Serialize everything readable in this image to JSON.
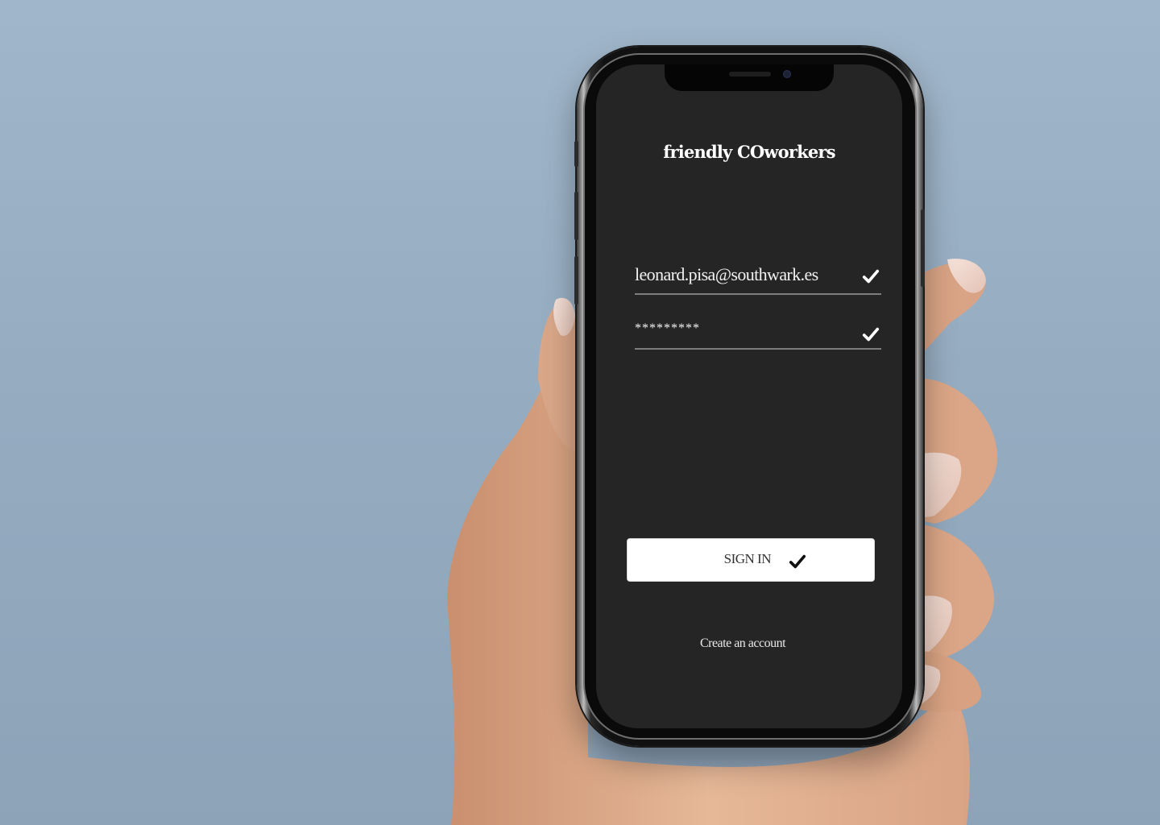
{
  "app": {
    "title": "friendly COworkers"
  },
  "login": {
    "email_value": "leonard.pisa@southwark.es",
    "password_value": "*********",
    "email_valid_icon": "check-icon",
    "password_valid_icon": "check-icon",
    "signin_label": "SIGN IN",
    "signin_icon": "check-icon",
    "create_account_label": "Create an account"
  },
  "colors": {
    "background": "#9bb1c6",
    "screen": "#252525",
    "button": "#ffffff",
    "text": "#ffffff"
  }
}
